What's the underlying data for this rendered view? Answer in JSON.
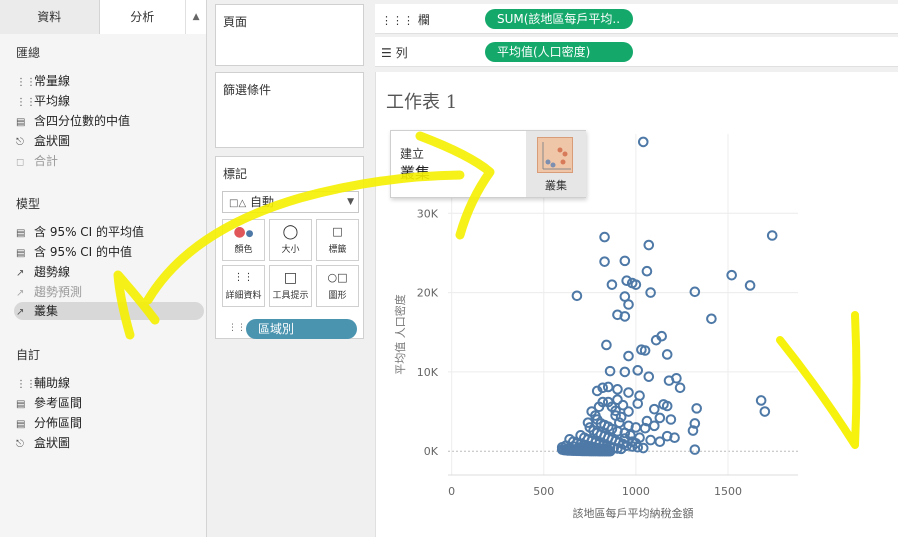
{
  "left_pane": {
    "tabs": {
      "data": "資料",
      "analysis": "分析",
      "sort_icon": "sort-icon"
    },
    "sections": [
      {
        "title": "匯總",
        "items": [
          {
            "label": "常量線",
            "icon": "reference-line-icon",
            "dim": false
          },
          {
            "label": "平均線",
            "icon": "average-line-icon",
            "dim": false
          },
          {
            "label": "含四分位數的中值",
            "icon": "median-quartile-icon",
            "dim": false
          },
          {
            "label": "盒狀圖",
            "icon": "box-plot-icon",
            "dim": false
          },
          {
            "label": "合計",
            "icon": "totals-icon",
            "dim": true
          }
        ]
      },
      {
        "title": "模型",
        "items": [
          {
            "label": "含 95% CI 的平均值",
            "icon": "average-ci-icon",
            "dim": false
          },
          {
            "label": "含 95% CI 的中值",
            "icon": "median-ci-icon",
            "dim": false
          },
          {
            "label": "趨勢線",
            "icon": "trend-line-icon",
            "dim": false
          },
          {
            "label": "趨勢預測",
            "icon": "forecast-icon",
            "dim": true
          },
          {
            "label": "叢集",
            "icon": "cluster-icon",
            "dim": false,
            "selected": true
          }
        ]
      },
      {
        "title": "自訂",
        "items": [
          {
            "label": "輔助線",
            "icon": "reference-line-icon",
            "dim": false
          },
          {
            "label": "參考區間",
            "icon": "reference-band-icon",
            "dim": false
          },
          {
            "label": "分佈區間",
            "icon": "distribution-band-icon",
            "dim": false
          },
          {
            "label": "盒狀圖",
            "icon": "box-plot-icon",
            "dim": false
          }
        ]
      }
    ]
  },
  "shelves": {
    "pages": "頁面",
    "filters": "篩選條件",
    "marks": {
      "title": "標記",
      "mark_type": "自動",
      "buttons": [
        "顏色",
        "大小",
        "標籤",
        "詳細資料",
        "工具提示",
        "圖形"
      ],
      "pill": "區域別"
    },
    "columns_label": "欄",
    "columns_pill": "SUM(該地區每戶平均..",
    "rows_label": "列",
    "rows_pill": "平均值(人口密度)"
  },
  "sheet": {
    "title": "工作表 1"
  },
  "tooltip": {
    "line1": "建立",
    "line2": "叢集",
    "icon_label": "叢集"
  },
  "chart_data": {
    "type": "scatter",
    "xlabel": "該地區每戶平均納稅金額",
    "ylabel": "平均值 人口密度",
    "xlim": [
      -20,
      1880
    ],
    "ylim": [
      -3000,
      40000
    ],
    "xticks": [
      "0",
      "500",
      "1000",
      "1500"
    ],
    "yticks": [
      "0K",
      "10K",
      "20K",
      "30K"
    ],
    "point_color": "#4e79a7",
    "points": [
      [
        1040,
        39000
      ],
      [
        1740,
        27200
      ],
      [
        830,
        27000
      ],
      [
        1070,
        26000
      ],
      [
        940,
        24000
      ],
      [
        830,
        23900
      ],
      [
        1060,
        22700
      ],
      [
        1520,
        22200
      ],
      [
        1620,
        20900
      ],
      [
        870,
        21000
      ],
      [
        950,
        21500
      ],
      [
        980,
        21200
      ],
      [
        1000,
        21000
      ],
      [
        1320,
        20100
      ],
      [
        680,
        19600
      ],
      [
        1080,
        20000
      ],
      [
        940,
        19500
      ],
      [
        960,
        18500
      ],
      [
        900,
        17200
      ],
      [
        940,
        17000
      ],
      [
        1410,
        16700
      ],
      [
        1140,
        14500
      ],
      [
        1110,
        14000
      ],
      [
        1030,
        12800
      ],
      [
        1050,
        12700
      ],
      [
        840,
        13400
      ],
      [
        1170,
        12200
      ],
      [
        960,
        12000
      ],
      [
        860,
        10100
      ],
      [
        940,
        10000
      ],
      [
        1010,
        10200
      ],
      [
        1070,
        9400
      ],
      [
        1220,
        9200
      ],
      [
        1180,
        8900
      ],
      [
        820,
        8000
      ],
      [
        850,
        8100
      ],
      [
        790,
        7600
      ],
      [
        900,
        7800
      ],
      [
        960,
        7400
      ],
      [
        1020,
        7000
      ],
      [
        1240,
        8000
      ],
      [
        1680,
        6400
      ],
      [
        1700,
        5000
      ],
      [
        1150,
        5900
      ],
      [
        1170,
        5700
      ],
      [
        1330,
        5400
      ],
      [
        1100,
        5300
      ],
      [
        1190,
        4000
      ],
      [
        1320,
        3500
      ],
      [
        1010,
        6000
      ],
      [
        900,
        6500
      ],
      [
        930,
        5800
      ],
      [
        960,
        5000
      ],
      [
        890,
        4500
      ],
      [
        910,
        3600
      ],
      [
        960,
        3200
      ],
      [
        1000,
        3000
      ],
      [
        1050,
        2900
      ],
      [
        1100,
        3200
      ],
      [
        1170,
        1900
      ],
      [
        1210,
        1700
      ],
      [
        1310,
        2600
      ],
      [
        780,
        4500
      ],
      [
        790,
        4000
      ],
      [
        810,
        3500
      ],
      [
        830,
        3300
      ],
      [
        850,
        3100
      ],
      [
        870,
        2800
      ],
      [
        900,
        2500
      ],
      [
        940,
        2300
      ],
      [
        970,
        2000
      ],
      [
        1020,
        1700
      ],
      [
        1080,
        1400
      ],
      [
        1130,
        1200
      ],
      [
        1320,
        200
      ],
      [
        750,
        3000
      ],
      [
        770,
        2600
      ],
      [
        790,
        2300
      ],
      [
        810,
        2100
      ],
      [
        830,
        1900
      ],
      [
        850,
        1700
      ],
      [
        870,
        1500
      ],
      [
        890,
        1300
      ],
      [
        910,
        1100
      ],
      [
        930,
        900
      ],
      [
        950,
        700
      ],
      [
        980,
        600
      ],
      [
        1010,
        500
      ],
      [
        1040,
        400
      ],
      [
        700,
        2000
      ],
      [
        720,
        1700
      ],
      [
        740,
        1500
      ],
      [
        760,
        1300
      ],
      [
        780,
        1100
      ],
      [
        800,
        900
      ],
      [
        820,
        700
      ],
      [
        840,
        600
      ],
      [
        860,
        500
      ],
      [
        880,
        400
      ],
      [
        900,
        350
      ],
      [
        920,
        300
      ],
      [
        640,
        1500
      ],
      [
        660,
        1200
      ],
      [
        680,
        1000
      ],
      [
        700,
        900
      ],
      [
        720,
        800
      ],
      [
        740,
        650
      ],
      [
        760,
        550
      ],
      [
        780,
        450
      ],
      [
        800,
        380
      ],
      [
        820,
        320
      ],
      [
        840,
        280
      ],
      [
        600,
        200
      ],
      [
        610,
        150
      ],
      [
        620,
        120
      ],
      [
        630,
        100
      ],
      [
        640,
        90
      ],
      [
        650,
        80
      ],
      [
        660,
        70
      ],
      [
        670,
        60
      ],
      [
        680,
        55
      ],
      [
        690,
        50
      ],
      [
        700,
        45
      ],
      [
        710,
        40
      ],
      [
        720,
        35
      ],
      [
        730,
        30
      ],
      [
        740,
        25
      ],
      [
        750,
        20
      ],
      [
        760,
        18
      ],
      [
        770,
        15
      ],
      [
        780,
        12
      ],
      [
        790,
        10
      ],
      [
        800,
        8
      ],
      [
        810,
        6
      ],
      [
        820,
        5
      ],
      [
        830,
        4
      ],
      [
        840,
        3
      ],
      [
        850,
        2
      ],
      [
        860,
        2
      ],
      [
        600,
        500
      ],
      [
        620,
        700
      ],
      [
        640,
        400
      ],
      [
        660,
        600
      ],
      [
        680,
        300
      ],
      [
        700,
        500
      ],
      [
        720,
        250
      ],
      [
        740,
        450
      ],
      [
        760,
        200
      ],
      [
        780,
        350
      ],
      [
        800,
        150
      ],
      [
        820,
        250
      ],
      [
        850,
        6200
      ],
      [
        870,
        5600
      ],
      [
        890,
        5100
      ],
      [
        920,
        4300
      ],
      [
        1130,
        4200
      ],
      [
        1060,
        3800
      ],
      [
        940,
        1600
      ],
      [
        980,
        1200
      ],
      [
        1000,
        1000
      ],
      [
        740,
        3600
      ],
      [
        760,
        5000
      ],
      [
        800,
        5600
      ],
      [
        820,
        6200
      ]
    ]
  }
}
